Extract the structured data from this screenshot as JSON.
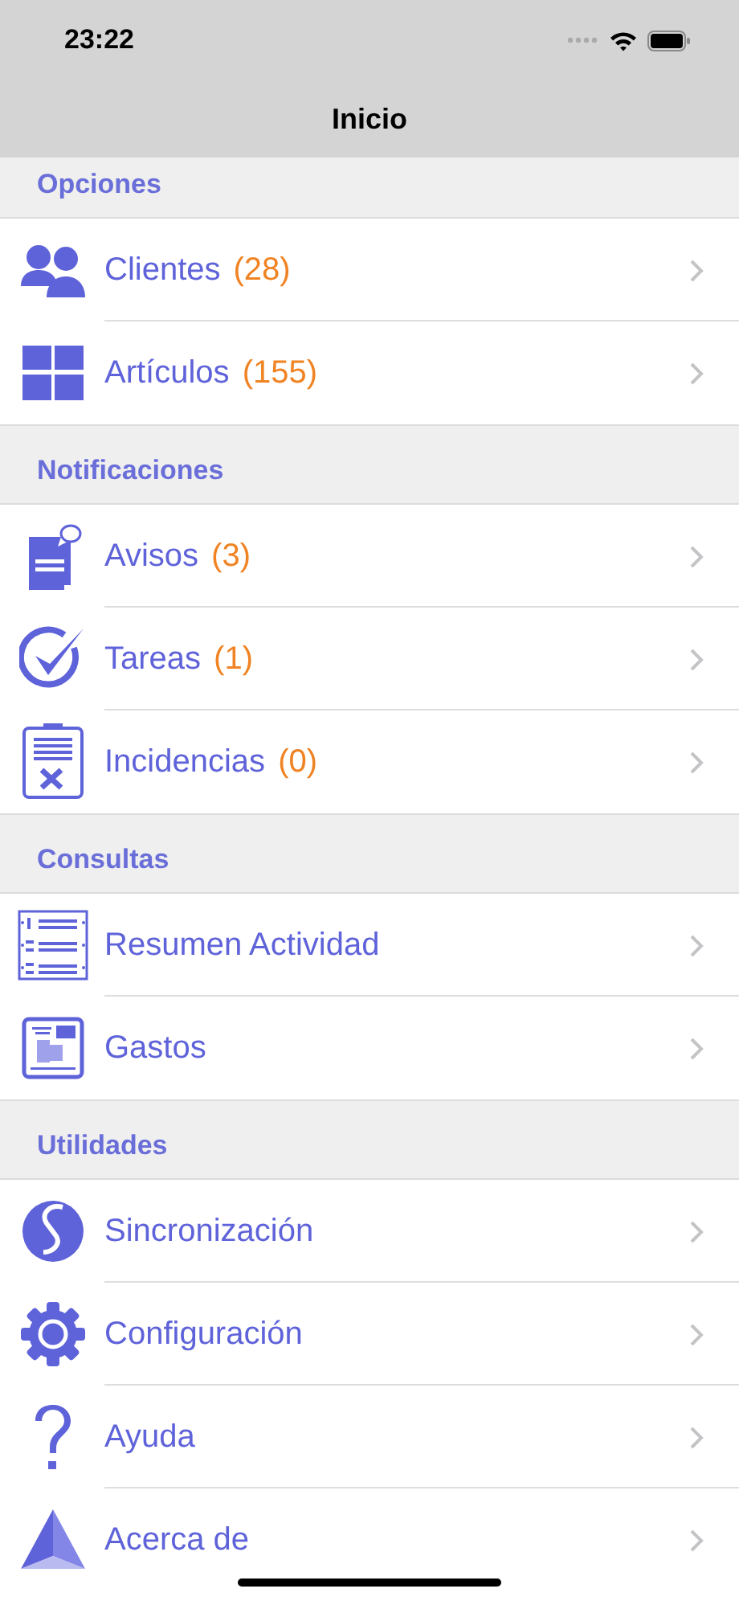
{
  "status_bar": {
    "time": "23:22"
  },
  "nav_bar": {
    "title": "Inicio"
  },
  "sections": [
    {
      "title": "Opciones",
      "items": [
        {
          "label": "Clientes",
          "count": "(28)"
        },
        {
          "label": "Artículos",
          "count": "(155)"
        }
      ]
    },
    {
      "title": "Notificaciones",
      "items": [
        {
          "label": "Avisos",
          "count": "(3)"
        },
        {
          "label": "Tareas",
          "count": "(1)"
        },
        {
          "label": "Incidencias",
          "count": "(0)"
        }
      ]
    },
    {
      "title": "Consultas",
      "items": [
        {
          "label": "Resumen Actividad"
        },
        {
          "label": "Gastos"
        }
      ]
    },
    {
      "title": "Utilidades",
      "items": [
        {
          "label": "Sincronización"
        },
        {
          "label": "Configuración"
        },
        {
          "label": "Ayuda"
        },
        {
          "label": "Acerca de"
        }
      ]
    }
  ]
}
